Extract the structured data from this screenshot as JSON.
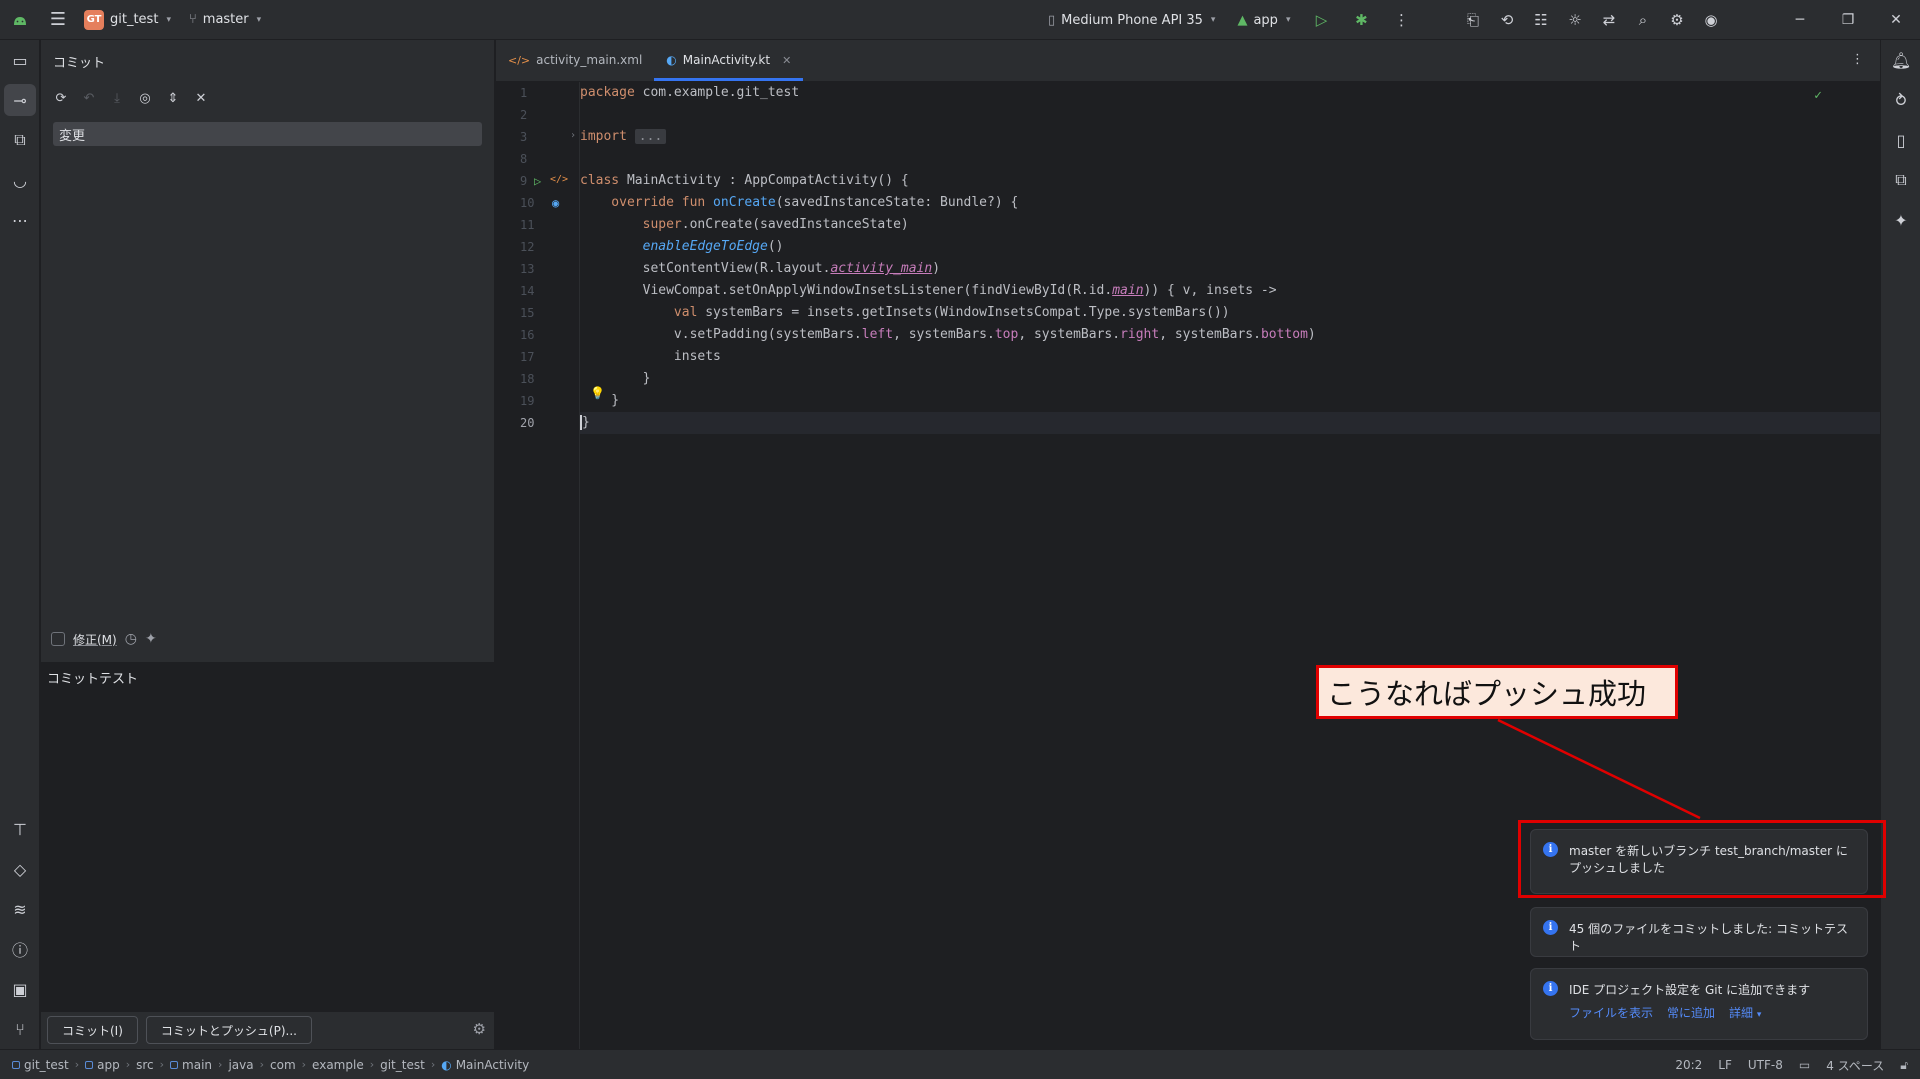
{
  "titlebar": {
    "project_badge": "GT",
    "project_name": "git_test",
    "branch": "master",
    "device": "Medium Phone API 35",
    "run_config": "app"
  },
  "commit_panel": {
    "title": "コミット",
    "changes_label": "変更",
    "amend_label": "修正(M)",
    "message": "コミットテスト",
    "commit_button": "コミット(I)",
    "commit_push_button": "コミットとプッシュ(P)..."
  },
  "editor": {
    "tabs": [
      {
        "label": "activity_main.xml"
      },
      {
        "label": "MainActivity.kt"
      }
    ],
    "line_numbers": [
      "1",
      "2",
      "3",
      "8",
      "9",
      "10",
      "11",
      "12",
      "13",
      "14",
      "15",
      "16",
      "17",
      "18",
      "19",
      "20"
    ],
    "code": {
      "l1_kw": "package",
      "l1_rest": " com.example.git_test",
      "l3_kw": "import",
      "l3_fold": "...",
      "l9_kw": "class",
      "l9_rest": " MainActivity : AppCompatActivity() {",
      "l10_kw": "    override fun",
      "l10_fn": " onCreate",
      "l10_rest": "(savedInstanceState: Bundle?) {",
      "l11_kw": "        super",
      "l11_rest": ".onCreate(savedInstanceState)",
      "l12_it": "        enableEdgeToEdge",
      "l12_rest": "()",
      "l13_pre": "        setContentView(R.layout.",
      "l13_pr": "activity_main",
      "l13_post": ")",
      "l14_pre": "        ViewCompat.setOnApplyWindowInsetsListener(findViewById(R.id.",
      "l14_pr": "main",
      "l14_post": ")) { v, insets ->",
      "l15_kw": "            val",
      "l15_rest": " systemBars = insets.getInsets(WindowInsetsCompat.Type.systemBars())",
      "l16_a": "            v.setPadding(systemBars.",
      "l16_b": "left",
      "l16_c": ", systemBars.",
      "l16_d": "top",
      "l16_e": ", systemBars.",
      "l16_f": "right",
      "l16_g": ", systemBars.",
      "l16_h": "bottom",
      "l16_i": ")",
      "l17": "            insets",
      "l18": "        }",
      "l19": "    }",
      "l20": "}"
    }
  },
  "notifications": [
    {
      "text": "master を新しいブランチ test_branch/master にプッシュしました"
    },
    {
      "text": "45 個のファイルをコミットしました: コミットテスト"
    },
    {
      "text": "IDE プロジェクト設定を Git に追加できます",
      "links": [
        "ファイルを表示",
        "常に追加",
        "詳細"
      ]
    }
  ],
  "annotation": {
    "callout_text": "こうなればプッシュ成功"
  },
  "breadcrumbs": [
    "git_test",
    "app",
    "src",
    "main",
    "java",
    "com",
    "example",
    "git_test",
    "MainActivity"
  ],
  "status": {
    "position": "20:2",
    "line_sep": "LF",
    "encoding": "UTF-8",
    "indent": "4 スペース"
  },
  "icons": {
    "titlebar": [
      "android-logo-icon",
      "menu-icon",
      "git-branch-icon",
      "device-icon",
      "android-run-icon",
      "run-icon",
      "debug-icon",
      "more-vertical-icon",
      "device-manager-icon",
      "translate-icon",
      "layout-icon",
      "bug-icon",
      "sync-icon",
      "search-icon",
      "settings-icon",
      "account-icon"
    ],
    "left_strip": [
      "folder-icon",
      "commit-icon",
      "structure-icon",
      "android-icon",
      "more-icon",
      "build-icon",
      "gem-icon",
      "logcat-icon",
      "problems-icon",
      "terminal-icon",
      "git-icon"
    ]
  },
  "colors": {
    "accent": "#3574f0",
    "annotation_red": "#e00000",
    "callout_bg": "#fce8dc",
    "keyword": "#cf8e6d",
    "function": "#56a8f5",
    "property": "#c77dbb"
  }
}
